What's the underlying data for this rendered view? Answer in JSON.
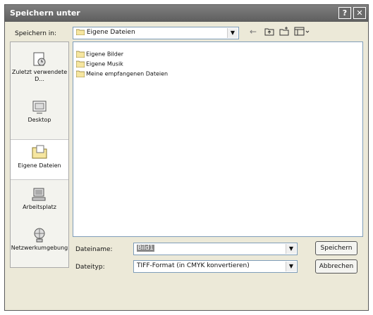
{
  "window": {
    "title": "Speichern unter"
  },
  "toolbar": {
    "save_in_label": "Speichern in:",
    "location": "Eigene Dateien"
  },
  "places": [
    {
      "label": "Zuletzt verwendete D..."
    },
    {
      "label": "Desktop"
    },
    {
      "label": "Eigene Dateien"
    },
    {
      "label": "Arbeitsplatz"
    },
    {
      "label": "Netzwerkumgebung"
    }
  ],
  "files": [
    {
      "name": "Eigene Bilder"
    },
    {
      "name": "Eigene Musik"
    },
    {
      "name": "Meine empfangenen Dateien"
    }
  ],
  "form": {
    "filename_label": "Dateiname:",
    "filename_value": "Bild1",
    "filetype_label": "Dateityp:",
    "filetype_value": "TIFF-Format (in CMYK konvertieren)"
  },
  "buttons": {
    "save": "Speichern",
    "cancel": "Abbrechen"
  }
}
